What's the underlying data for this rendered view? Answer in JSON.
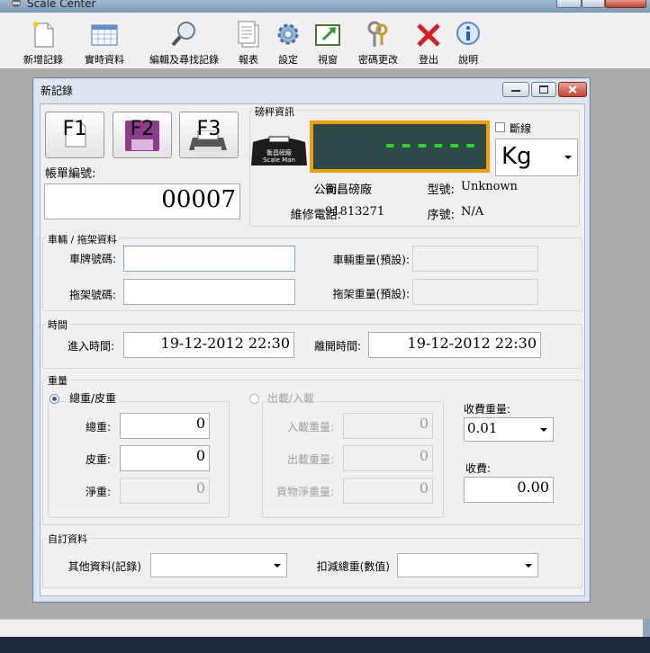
{
  "app": {
    "title": "Scale Center"
  },
  "toolbar": [
    {
      "label": "新增記錄",
      "icon": "new-document-icon"
    },
    {
      "label": "實時資料",
      "icon": "table-grid-icon"
    },
    {
      "label": "編輯及尋找記錄",
      "icon": "magnifier-icon"
    },
    {
      "label": "報表",
      "icon": "report-icon"
    },
    {
      "label": "設定",
      "icon": "gear-icon"
    },
    {
      "label": "視窗",
      "icon": "window-arrow-icon"
    },
    {
      "label": "密碼更改",
      "icon": "keys-icon"
    },
    {
      "label": "登出",
      "icon": "red-x-icon"
    },
    {
      "label": "說明",
      "icon": "info-icon"
    }
  ],
  "dialog": {
    "title": "新記錄",
    "f_buttons": [
      {
        "label": "F1"
      },
      {
        "label": "F2"
      },
      {
        "label": "F3"
      }
    ],
    "ticket": {
      "label": "帳單編號:",
      "value": "00007"
    },
    "scale": {
      "section_label": "磅秤資訊",
      "logo_line1": "衡昌磅廠",
      "logo_line2": "Scale Man",
      "display": "------",
      "disconnect_label": "斷線",
      "unit": "Kg",
      "company_label": "公司:",
      "company_value": "衡昌磅廠",
      "model_label": "型號:",
      "model_value": "Unknown",
      "phone_label": "維修電話:",
      "phone_value": "91813271",
      "serial_label": "序號:",
      "serial_value": "N/A"
    },
    "vehicle": {
      "section_label": "車輛 / 拖架資料",
      "plate_label": "車牌號碼:",
      "plate_value": "",
      "trailer_label": "拖架號碼:",
      "trailer_value": "",
      "vehicle_weight_label": "車輛重量(預設):",
      "vehicle_weight_value": "",
      "trailer_weight_label": "拖架重量(預設):",
      "trailer_weight_value": ""
    },
    "time": {
      "section_label": "時間",
      "in_label": "進入時間:",
      "in_value": "19-12-2012 22:30",
      "out_label": "離開時間:",
      "out_value": "19-12-2012 22:30"
    },
    "weight": {
      "section_label": "重量",
      "gross_tare_label": "總重/皮重",
      "gross_label": "總重:",
      "gross_value": "0",
      "tare_label": "皮重:",
      "tare_value": "0",
      "net_label": "淨重:",
      "net_value": "0",
      "in_out_label": "出載/入載",
      "load_in_label": "入載重量:",
      "load_in_value": "0",
      "load_out_label": "出載重量:",
      "load_out_value": "0",
      "cargo_net_label": "貨物淨重量:",
      "cargo_net_value": "0",
      "charge_weight_label": "收費重量:",
      "charge_weight_value": "0.01",
      "charge_label": "收費:",
      "charge_value": "0.00"
    },
    "custom": {
      "section_label": "自訂資料",
      "other_label": "其他資料(記錄)",
      "other_value": "",
      "deduct_label": "扣減總重(數值)",
      "deduct_value": ""
    }
  },
  "colors": {
    "display_bg": "#2e4a48",
    "display_border": "#f0a000",
    "display_digits": "#22dd22"
  }
}
